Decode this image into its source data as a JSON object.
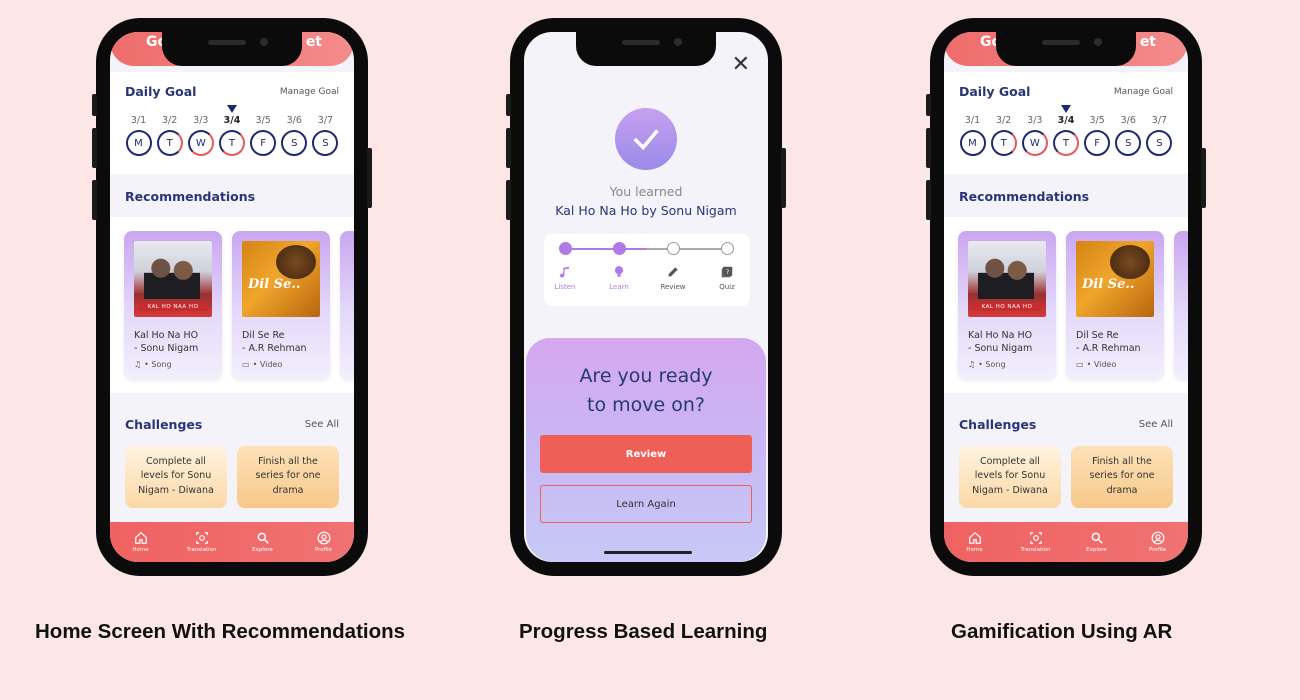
{
  "captions": [
    "Home Screen With Recommendations",
    "Progress Based Learning",
    "Gamification Using AR"
  ],
  "home": {
    "app_title": "Go",
    "app_title_right": "et",
    "daily_goal_title": "Daily Goal",
    "manage_goal": "Manage Goal",
    "days": [
      {
        "date": "3/1",
        "letter": "M"
      },
      {
        "date": "3/2",
        "letter": "T"
      },
      {
        "date": "3/3",
        "letter": "W"
      },
      {
        "date": "3/4",
        "letter": "T"
      },
      {
        "date": "3/5",
        "letter": "F"
      },
      {
        "date": "3/6",
        "letter": "S"
      },
      {
        "date": "3/7",
        "letter": "S"
      }
    ],
    "recommendations_title": "Recommendations",
    "cards": [
      {
        "name_line1": "Kal Ho Na HO",
        "name_line2": "- Sonu Nigam",
        "meta": "• Song",
        "poster_text": "KAL HO NAA HO"
      },
      {
        "name_line1": "Dil Se Re",
        "name_line2": "- A.R Rehman",
        "meta": "• Video",
        "poster_text": "Dil Se.."
      }
    ],
    "challenges_title": "Challenges",
    "see_all": "See All",
    "challenge_cards": [
      "Complete all levels for Sonu Nigam - Diwana",
      "Finish all the series for one drama"
    ],
    "nav": [
      "Home",
      "Translation",
      "Explore",
      "Profile"
    ]
  },
  "progress": {
    "you_learned": "You learned",
    "song": "Kal Ho Na Ho by Sonu Nigam",
    "steps": [
      "Listen",
      "Learn",
      "Review",
      "Quiz"
    ],
    "question_line1": "Are you ready",
    "question_line2": "to move on?",
    "review_btn": "Review",
    "learn_again_btn": "Learn Again"
  },
  "colors": {
    "accent": "#ef6262",
    "navy": "#1e2a6e",
    "purple": "#b07ae6"
  }
}
